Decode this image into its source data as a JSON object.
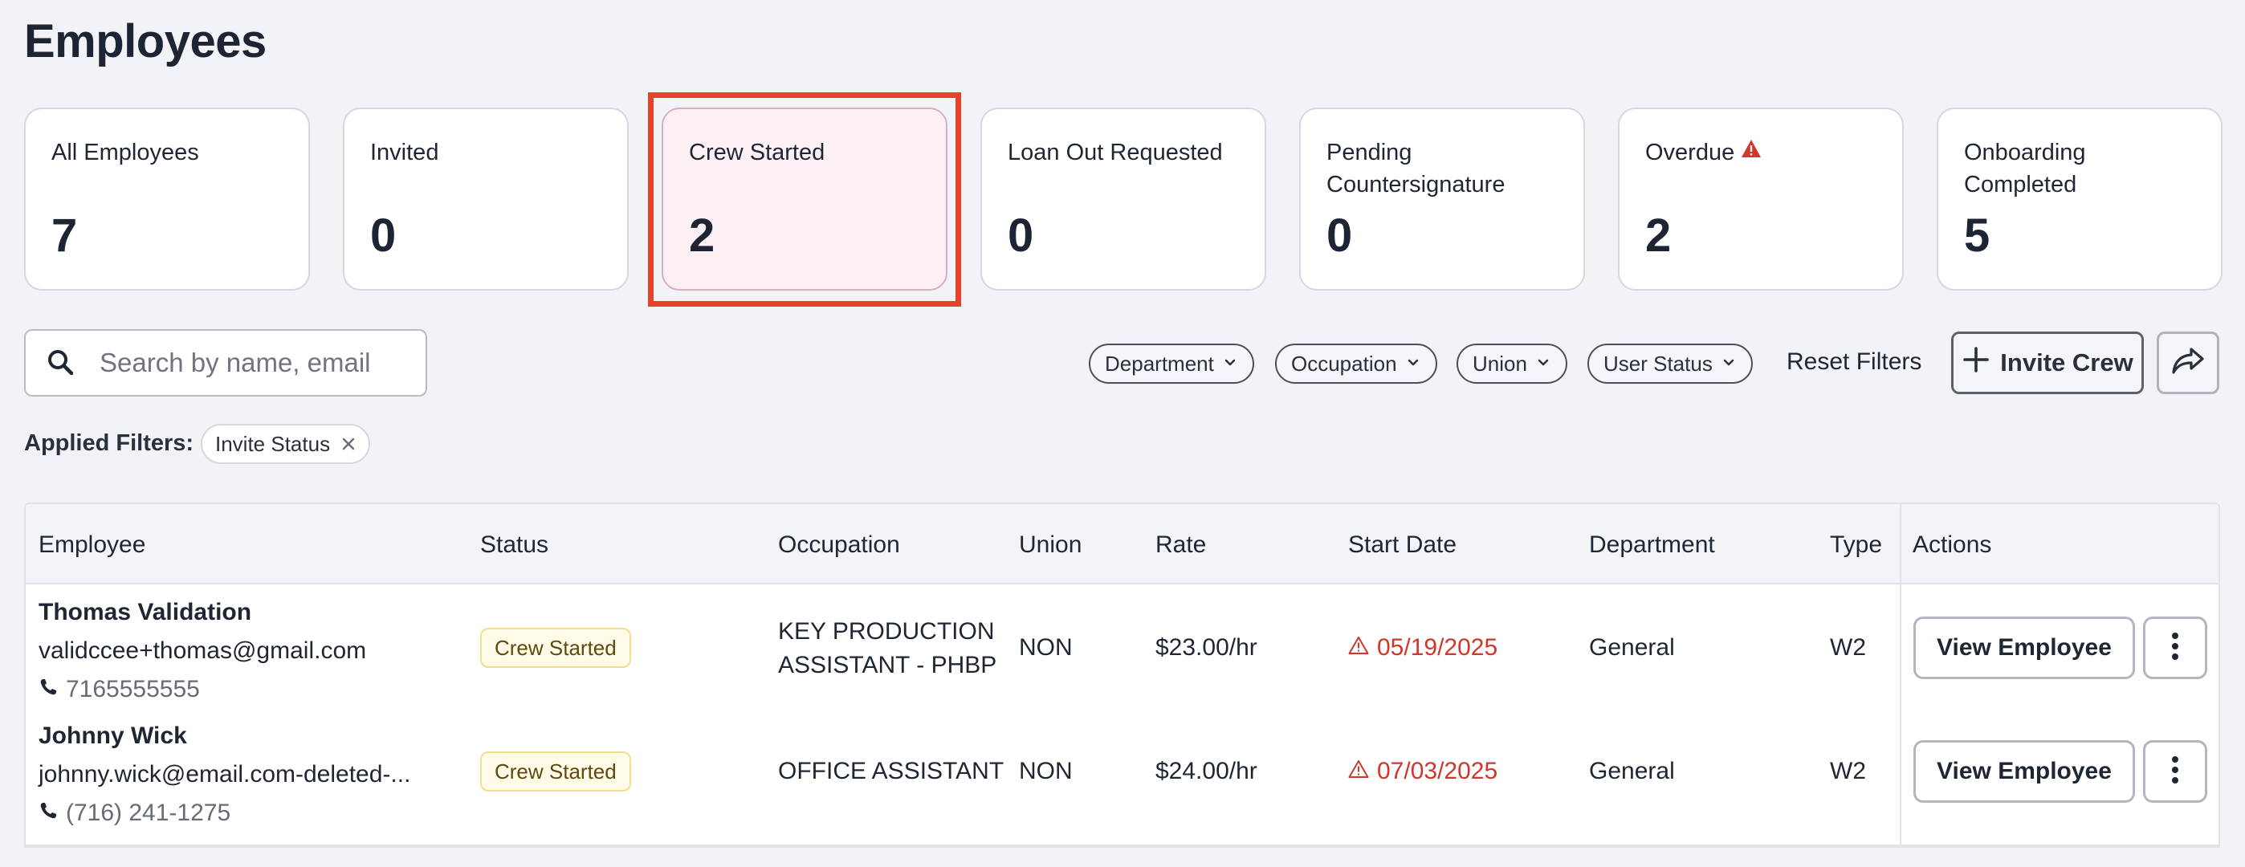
{
  "page": {
    "title": "Employees"
  },
  "cards": [
    {
      "label": "All Employees",
      "value": "7"
    },
    {
      "label": "Invited",
      "value": "0"
    },
    {
      "label": "Crew Started",
      "value": "2",
      "selected": true
    },
    {
      "label": "Loan Out Requested",
      "value": "0"
    },
    {
      "label": "Pending Countersignature",
      "value": "0"
    },
    {
      "label": "Overdue",
      "value": "2",
      "icon": "warning-icon"
    },
    {
      "label": "Onboarding Completed",
      "value": "5"
    }
  ],
  "search": {
    "placeholder": "Search by name, email",
    "value": ""
  },
  "filters": [
    {
      "label": "Department"
    },
    {
      "label": "Occupation"
    },
    {
      "label": "Union"
    },
    {
      "label": "User Status"
    }
  ],
  "toolbar": {
    "reset_label": "Reset Filters",
    "invite_label": "Invite Crew",
    "share_icon": "share-icon"
  },
  "applied": {
    "label": "Applied Filters:",
    "chips": [
      {
        "label": "Invite Status"
      }
    ]
  },
  "table": {
    "columns": [
      "Employee",
      "Status",
      "Occupation",
      "Union",
      "Rate",
      "Start Date",
      "Department",
      "Type",
      "Actions"
    ],
    "rows": [
      {
        "name": "Thomas Validation",
        "email": "validccee+thomas@gmail.com",
        "phone": "7165555555",
        "status": "Crew Started",
        "occupation_line1": "KEY PRODUCTION",
        "occupation_line2": "ASSISTANT - PHBP",
        "union": "NON",
        "rate": "$23.00/hr",
        "start_date": "05/19/2025",
        "department": "General",
        "type": "W2",
        "action_label": "View Employee"
      },
      {
        "name": "Johnny Wick",
        "email": "johnny.wick@email.com-deleted-...",
        "phone": "(716) 241-1275",
        "status": "Crew Started",
        "occupation_line1": "OFFICE ASSISTANT",
        "occupation_line2": "",
        "union": "NON",
        "rate": "$24.00/hr",
        "start_date": "07/03/2025",
        "department": "General",
        "type": "W2",
        "action_label": "View Employee"
      }
    ]
  },
  "colors": {
    "accent_highlight": "#e5432c",
    "selected_card_bg": "#fdf0f5",
    "badge_bg": "#fffbe8",
    "warning": "#d0362b"
  }
}
